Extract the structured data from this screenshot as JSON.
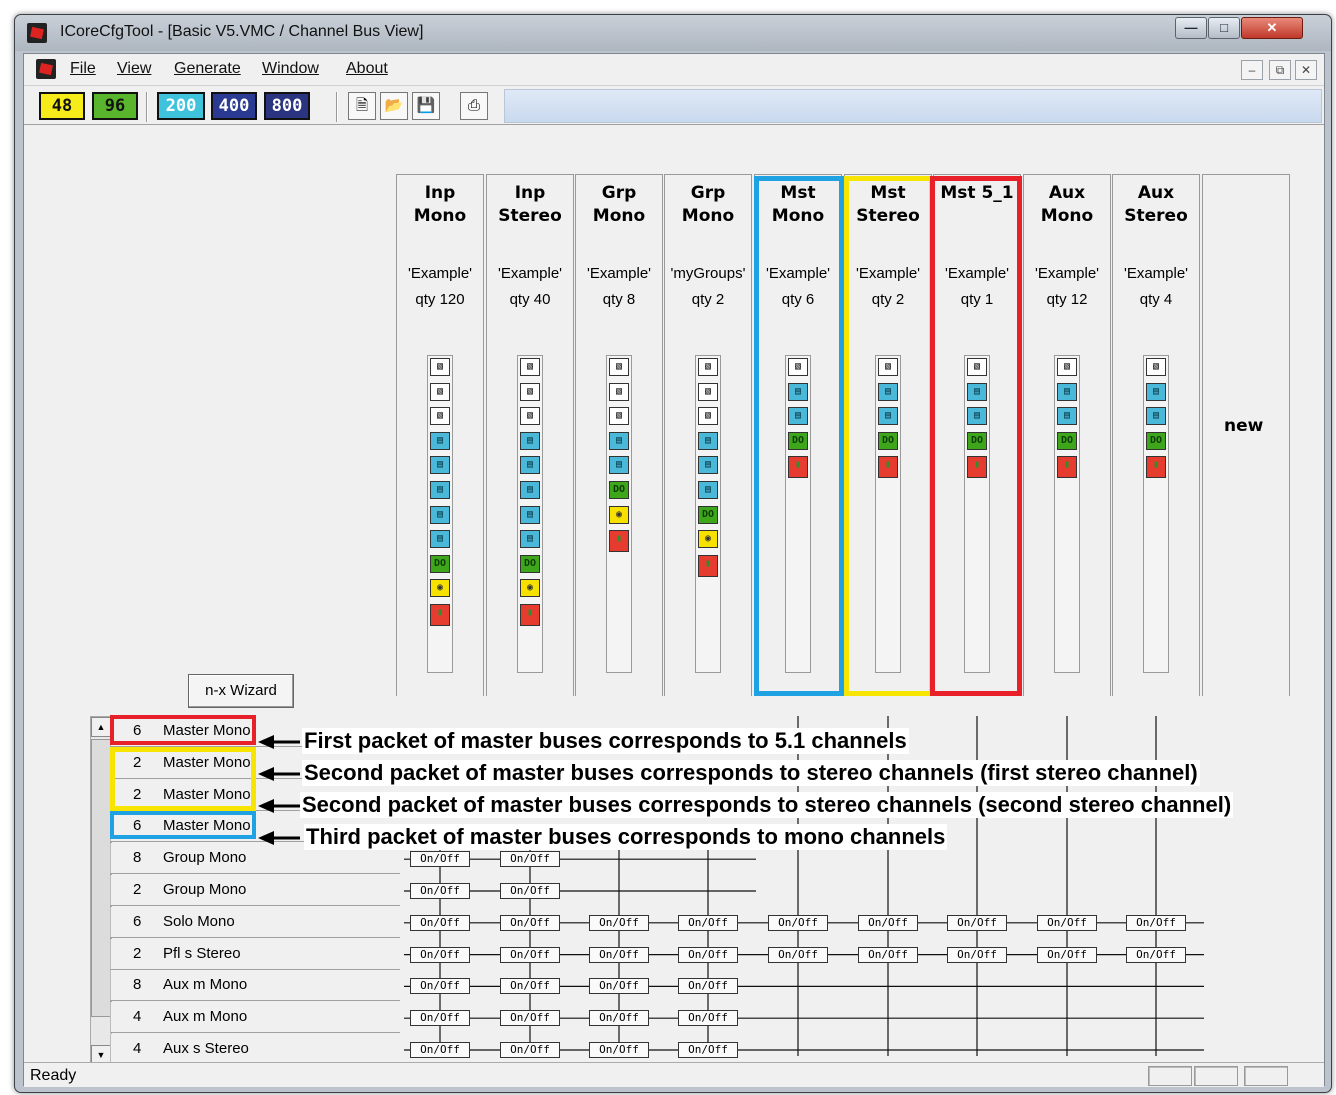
{
  "window": {
    "title": "ICoreCfgTool - [Basic V5.VMC / Channel Bus View]"
  },
  "menu": [
    {
      "label": "File"
    },
    {
      "label": "View"
    },
    {
      "label": "Generate"
    },
    {
      "label": "Window"
    },
    {
      "label": "About"
    }
  ],
  "toolbar": {
    "rate_buttons": [
      {
        "label": "48",
        "bg": "#f6ec1a",
        "fg": "#111"
      },
      {
        "label": "96",
        "bg": "#59b52b",
        "fg": "#111"
      }
    ],
    "block_buttons": [
      {
        "label": "200",
        "bg": "#3fc3dc",
        "fg": "#ffffff"
      },
      {
        "label": "400",
        "bg": "#2a3a92",
        "fg": "#ffffff"
      },
      {
        "label": "800",
        "bg": "#2b3480",
        "fg": "#ffffff"
      }
    ],
    "file_icons": [
      "new-file-icon",
      "open-folder-icon",
      "save-disk-icon",
      "print-icon"
    ]
  },
  "columns": [
    {
      "title1": "Inp",
      "title2": "Mono",
      "name": "'Example'",
      "qty": "qty 120"
    },
    {
      "title1": "Inp",
      "title2": "Stereo",
      "name": "'Example'",
      "qty": "qty 40"
    },
    {
      "title1": "Grp",
      "title2": "Mono",
      "name": "'Example'",
      "qty": "qty 8"
    },
    {
      "title1": "Grp",
      "title2": "Mono",
      "name": "'myGroups'",
      "qty": "qty 2"
    },
    {
      "title1": "Mst",
      "title2": "Mono",
      "name": "'Example'",
      "qty": "qty 6"
    },
    {
      "title1": "Mst",
      "title2": "Stereo",
      "name": "'Example'",
      "qty": "qty 2"
    },
    {
      "title1": "Mst 5_1",
      "title2": "",
      "name": "'Example'",
      "qty": "qty 1"
    },
    {
      "title1": "Aux",
      "title2": "Mono",
      "name": "'Example'",
      "qty": "qty 12"
    },
    {
      "title1": "Aux",
      "title2": "Stereo",
      "name": "'Example'",
      "qty": "qty 4"
    }
  ],
  "new_column": {
    "label": "new"
  },
  "wizard_button": {
    "label": "n-x Wizard"
  },
  "rows": [
    {
      "qty": "6",
      "name": "Master Mono"
    },
    {
      "qty": "2",
      "name": "Master Mono"
    },
    {
      "qty": "2",
      "name": "Master Mono"
    },
    {
      "qty": "6",
      "name": "Master Mono"
    },
    {
      "qty": "8",
      "name": "Group Mono"
    },
    {
      "qty": "2",
      "name": "Group Mono"
    },
    {
      "qty": "6",
      "name": "Solo Mono"
    },
    {
      "qty": "2",
      "name": "Pfl s Stereo"
    },
    {
      "qty": "8",
      "name": "Aux m Mono"
    },
    {
      "qty": "4",
      "name": "Aux m Mono"
    },
    {
      "qty": "4",
      "name": "Aux s Stereo"
    }
  ],
  "switch_label": "On/Off",
  "annotations": [
    "First packet of master buses corresponds to 5.1 channels",
    "Second packet of master buses corresponds to stereo channels (first stereo channel)",
    "Second packet of master buses corresponds to stereo channels (second stereo channel)",
    "Third packet of master buses corresponds to mono channels"
  ],
  "highlight_colors": {
    "red": "#e8202a",
    "yellow": "#f7e400",
    "blue": "#1ea2e4"
  },
  "status": {
    "text": "Ready"
  }
}
